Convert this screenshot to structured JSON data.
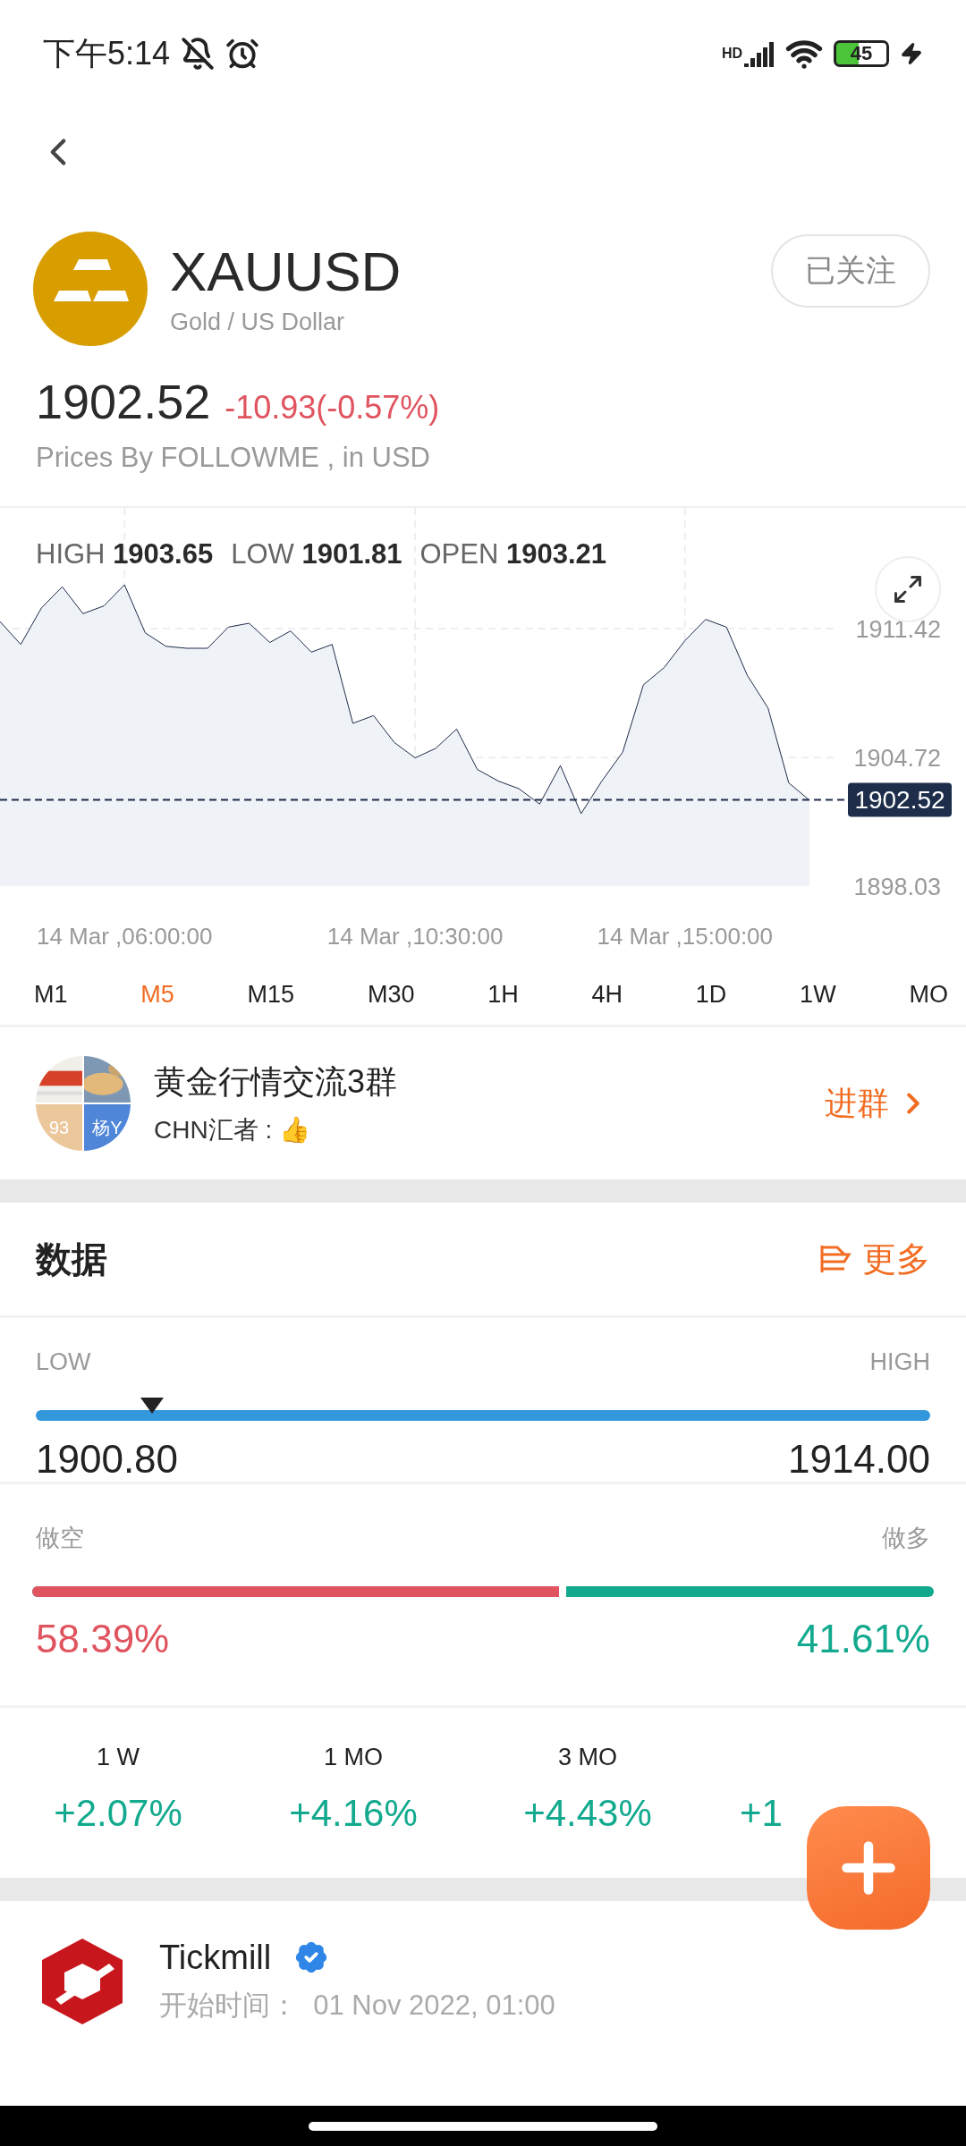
{
  "status_bar": {
    "time": "下午5:14",
    "network": "HD",
    "battery": "45"
  },
  "header": {
    "symbol": "XAUUSD",
    "name": "Gold / US Dollar",
    "follow_button": "已关注"
  },
  "quote": {
    "price": "1902.52",
    "change": "-10.93(-0.57%)",
    "source": "Prices By FOLLOWME , in USD"
  },
  "chart": {
    "stats": [
      {
        "label": "HIGH",
        "value": "1903.65"
      },
      {
        "label": "LOW",
        "value": "1901.81"
      },
      {
        "label": "OPEN",
        "value": "1903.21"
      }
    ],
    "chart_data": {
      "type": "area",
      "grid": true,
      "ref_lines": [
        {
          "axis": "y",
          "value": 1902.52,
          "label": "1902.52"
        }
      ],
      "categories": [
        null,
        null,
        null,
        null,
        null,
        null,
        "14 Mar ,06:00:00",
        null,
        null,
        null,
        null,
        null,
        null,
        null,
        null,
        null,
        null,
        null,
        null,
        null,
        "14 Mar ,10:30:00",
        null,
        null,
        null,
        null,
        null,
        null,
        null,
        null,
        null,
        null,
        null,
        null,
        "14 Mar ,15:00:00",
        null,
        null,
        null,
        null,
        null,
        null
      ],
      "series": [
        {
          "color": "#1e2d4a",
          "values": [
            1911.79,
            1910.6,
            1912.5,
            1913.6,
            1912.2,
            1912.6,
            1913.7,
            1911.2,
            1910.5,
            1910.4,
            1910.4,
            1911.5,
            1911.7,
            1910.7,
            1911.3,
            1910.2,
            1910.6,
            1906.5,
            1906.9,
            1905.5,
            1904.7,
            1905.2,
            1906.2,
            1904.1,
            1903.5,
            1903.1,
            1902.3,
            1904.3,
            1901.8,
            1903.5,
            1905.0,
            1908.5,
            1909.4,
            1910.8,
            1911.9,
            1911.5,
            1909.0,
            1907.3,
            1903.4,
            1902.5
          ]
        }
      ],
      "ylim": [
        1898.03,
        1917.7
      ],
      "yticks": [
        1898.03,
        1904.72,
        1911.42
      ]
    }
  },
  "timeframes": [
    {
      "label": "M1",
      "selected": false
    },
    {
      "label": "M5",
      "selected": true
    },
    {
      "label": "M15",
      "selected": false
    },
    {
      "label": "M30",
      "selected": false
    },
    {
      "label": "1H",
      "selected": false
    },
    {
      "label": "4H",
      "selected": false
    },
    {
      "label": "1D",
      "selected": false
    },
    {
      "label": "1W",
      "selected": false
    },
    {
      "label": "MO",
      "selected": false
    }
  ],
  "group": {
    "name": "黄金行情交流3群",
    "last_message": "CHN汇者 : 👍",
    "join_button": "进群",
    "avatar_tiles": [
      "93",
      "杨Y"
    ]
  },
  "data_section": {
    "title": "数据",
    "more_button": "更多"
  },
  "range": {
    "low_label": "LOW",
    "high_label": "HIGH",
    "low": "1900.80",
    "high": "1914.00",
    "level": 0.13
  },
  "sentiment": {
    "short_label": "做空",
    "long_label": "做多",
    "short_percent": "58.39%",
    "long_percent": "41.61%",
    "level": 0.584
  },
  "performance": [
    {
      "period": "1 W",
      "change": "+2.07%"
    },
    {
      "period": "1 MO",
      "change": "+4.16%"
    },
    {
      "period": "3 MO",
      "change": "+4.43%"
    },
    {
      "change": "+1"
    }
  ],
  "broker": {
    "name": "Tickmill",
    "verified": true,
    "start_time": "开始时间：  01 Nov 2022, 01:00"
  }
}
